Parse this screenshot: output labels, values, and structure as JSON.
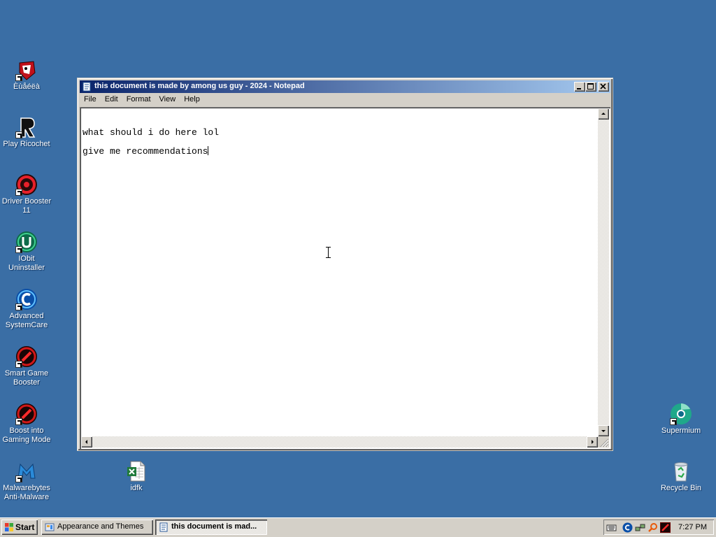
{
  "desktop": {
    "icons": [
      {
        "label": "Èùåéëà"
      },
      {
        "label": "Play Ricochet"
      },
      {
        "label": "Driver Booster 11"
      },
      {
        "label": "IObit Uninstaller"
      },
      {
        "label": "Advanced SystemCare"
      },
      {
        "label": "Smart Game Booster"
      },
      {
        "label": "Boost into Gaming Mode"
      },
      {
        "label": "Malwarebytes Anti-Malware"
      },
      {
        "label": "idfk"
      },
      {
        "label": "Supermium"
      },
      {
        "label": "Recycle Bin"
      }
    ]
  },
  "notepad": {
    "title": "this document is made by among us guy - 2024 - Notepad",
    "menu": [
      "File",
      "Edit",
      "Format",
      "View",
      "Help"
    ],
    "lines": [
      "what should i do here lol",
      "give me recommendations"
    ]
  },
  "taskbar": {
    "start_label": "Start",
    "tasks": [
      {
        "label": "Appearance and Themes"
      },
      {
        "label": "this document is mad..."
      }
    ],
    "clock": "7:27 PM"
  },
  "colors": {
    "desktop": "#3a6ea5",
    "title_active_start": "#0a246a",
    "title_active_end": "#a6caf0",
    "face": "#d4d0c8"
  }
}
